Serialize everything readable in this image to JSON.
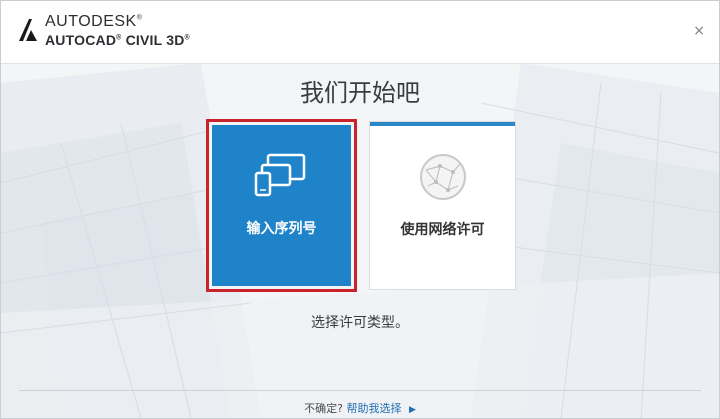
{
  "header": {
    "brand_line1": "AUTODESK",
    "brand_line1_mark": "®",
    "brand_line2": "AUTOCAD",
    "brand_line2_mark": "®",
    "brand_line2_product": "CIVIL 3D",
    "brand_line2_mark2": "®",
    "close_label": "×",
    "logo_icon": "autodesk-logo-icon"
  },
  "main": {
    "title": "我们开始吧",
    "cards": [
      {
        "label": "输入序列号",
        "icon": "devices-icon",
        "selected": true,
        "color": "#1f83c9"
      },
      {
        "label": "使用网络许可",
        "icon": "network-globe-icon",
        "selected": false,
        "color": "#ffffff"
      }
    ],
    "hint": "选择许可类型。"
  },
  "footer": {
    "question": "不确定?",
    "help_link": "帮助我选择",
    "arrow_icon": "triangle-right-icon"
  },
  "colors": {
    "accent": "#1f83c9",
    "highlight_border": "#c8232c",
    "link": "#1f6fb2"
  }
}
